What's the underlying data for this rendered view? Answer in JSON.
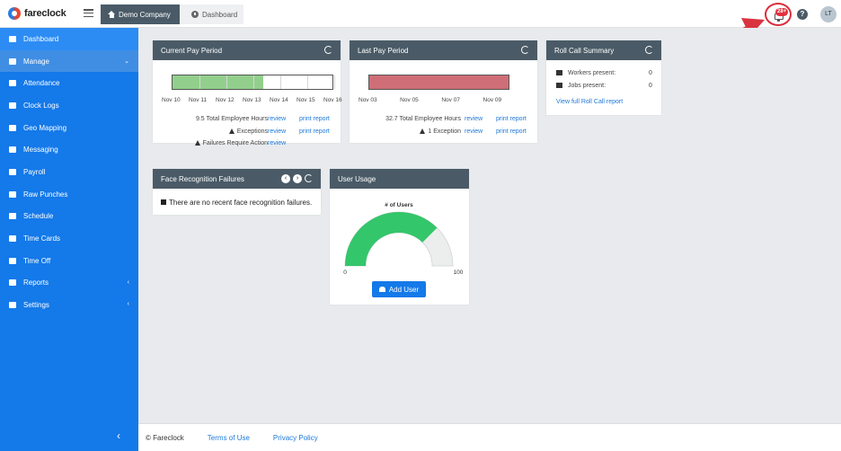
{
  "app": {
    "logo_text": "fareclock"
  },
  "breadcrumb": {
    "company": "Demo Company",
    "page": "Dashboard"
  },
  "header": {
    "notification_count": "28+",
    "help_label": "?",
    "avatar_initials": "LT"
  },
  "sidebar": {
    "items": [
      {
        "label": "Dashboard",
        "icon": "gauge-icon"
      },
      {
        "label": "Manage",
        "icon": "user-icon",
        "chevron": "⌄"
      },
      {
        "label": "Attendance",
        "icon": "grid-icon"
      },
      {
        "label": "Clock Logs",
        "icon": "clock-icon"
      },
      {
        "label": "Geo Mapping",
        "icon": "map-icon"
      },
      {
        "label": "Messaging",
        "icon": "chat-icon"
      },
      {
        "label": "Payroll",
        "icon": "money-icon"
      },
      {
        "label": "Raw Punches",
        "icon": "truck-icon"
      },
      {
        "label": "Schedule",
        "icon": "calendar-icon"
      },
      {
        "label": "Time Cards",
        "icon": "card-icon"
      },
      {
        "label": "Time Off",
        "icon": "umbrella-icon"
      },
      {
        "label": "Reports",
        "icon": "chart-icon",
        "chevron": "‹"
      },
      {
        "label": "Settings",
        "icon": "gear-icon",
        "chevron": "‹"
      }
    ],
    "collapse_label": "‹"
  },
  "current_pay_period": {
    "title": "Current Pay Period",
    "fill_fraction": 0.57,
    "ticks": [
      "Nov 10",
      "Nov 11",
      "Nov 12",
      "Nov 13",
      "Nov 14",
      "Nov 15",
      "Nov 16"
    ],
    "total_hours": "9.5 Total Employee Hours",
    "exceptions": "Exceptions",
    "failures": "Failures Require Action",
    "review": "review",
    "print_report": "print report"
  },
  "last_pay_period": {
    "title": "Last Pay Period",
    "fill_fraction": 1.0,
    "ticks": [
      "Nov 03",
      "Nov 05",
      "Nov 07",
      "Nov 09"
    ],
    "total_hours": "32.7 Total Employee Hours",
    "exceptions": "1 Exception",
    "review": "review",
    "print_report": "print report"
  },
  "roll_call": {
    "title": "Roll Call Summary",
    "workers_label": "Workers present:",
    "workers_value": "0",
    "jobs_label": "Jobs present:",
    "jobs_value": "0",
    "link": "View full Roll Call report"
  },
  "face_recognition": {
    "title": "Face Recognition Failures",
    "message": "There are no recent face recognition failures."
  },
  "user_usage": {
    "title": "User Usage",
    "chart_title": "# of Users",
    "min_label": "0",
    "max_label": "100",
    "add_user": "Add User"
  },
  "chart_data": {
    "type": "gauge",
    "title": "# of Users",
    "min": 0,
    "max": 100,
    "value": 75
  },
  "footer": {
    "copyright": "© Fareclock",
    "terms": "Terms of Use",
    "privacy": "Privacy Policy"
  },
  "colors": {
    "sidebar": "#1479e9",
    "card_header": "#4a5b67",
    "current_bar": "#92cf8c",
    "last_bar": "#cf6e77",
    "gauge_fill": "#34c66b",
    "gauge_track": "#eceeee",
    "annotation_arrow": "#d9343f"
  }
}
